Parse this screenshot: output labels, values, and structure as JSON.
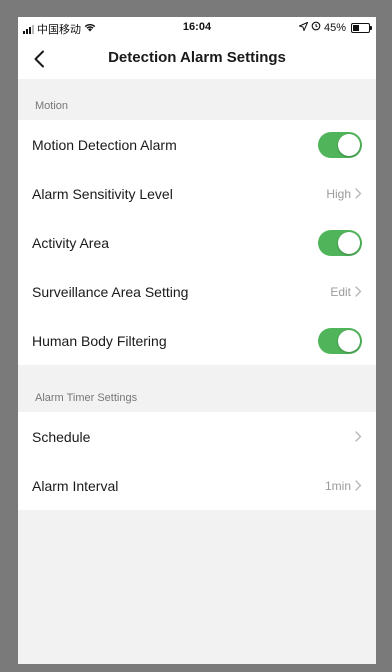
{
  "status_bar": {
    "carrier": "中国移动",
    "time": "16:04",
    "battery": "45%",
    "battery_level": 0.45
  },
  "nav": {
    "title": "Detection Alarm Settings"
  },
  "sections": [
    {
      "header": "Motion",
      "rows": [
        {
          "label": "Motion Detection Alarm",
          "type": "toggle",
          "on": true
        },
        {
          "label": "Alarm Sensitivity Level",
          "type": "link",
          "value": "High"
        },
        {
          "label": "Activity Area",
          "type": "toggle",
          "on": true
        },
        {
          "label": "Surveillance Area Setting",
          "type": "link",
          "value": "Edit"
        },
        {
          "label": "Human Body Filtering",
          "type": "toggle",
          "on": true
        }
      ]
    },
    {
      "header": "Alarm Timer Settings",
      "rows": [
        {
          "label": "Schedule",
          "type": "link",
          "value": ""
        },
        {
          "label": "Alarm Interval",
          "type": "link",
          "value": "1min"
        }
      ]
    }
  ],
  "colors": {
    "toggle_on": "#50b45a",
    "background": "#f2f2f2",
    "value_text": "#9b9b9b"
  },
  "icons": {
    "back": "chevron-left-icon",
    "row_link": "chevron-right-icon"
  }
}
